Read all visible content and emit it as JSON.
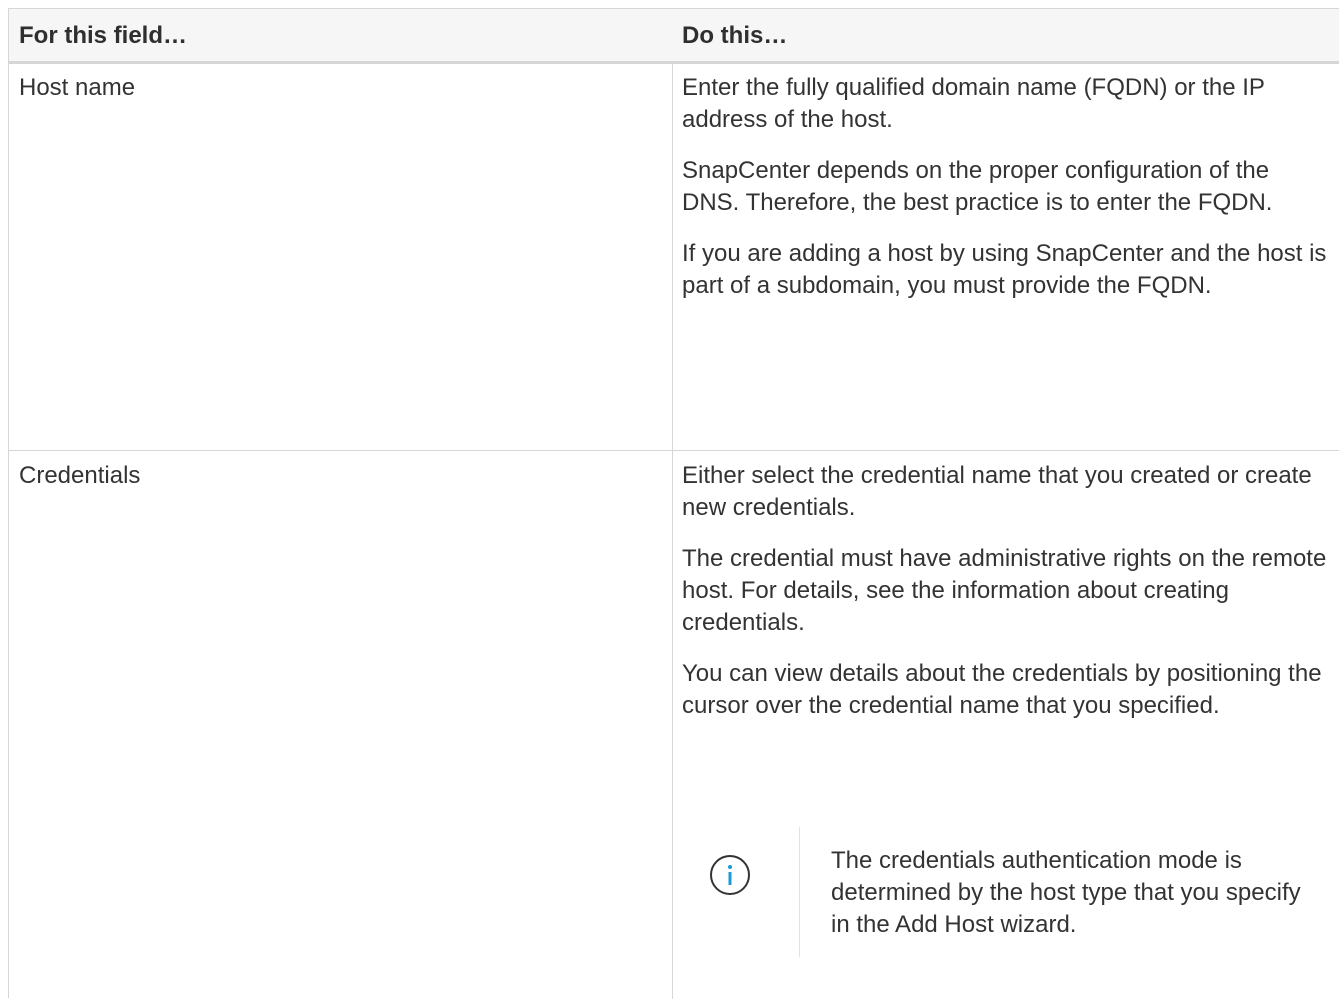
{
  "table": {
    "headers": {
      "field": "For this field…",
      "action": "Do this…"
    },
    "rows": [
      {
        "field": "Host name",
        "paragraphs": [
          "Enter the fully qualified domain name (FQDN) or the IP address of the host.",
          "SnapCenter depends on the proper configuration of the DNS. Therefore, the best practice is to enter the FQDN.",
          "If you are adding a host by using SnapCenter and the host is part of a subdomain, you must provide the FQDN."
        ]
      },
      {
        "field": "Credentials",
        "paragraphs": [
          "Either select the credential name that you created or create new credentials.",
          "The credential must have administrative rights on the remote host. For details, see the information about creating credentials.",
          "You can view details about the credentials by positioning the cursor over the credential name that you specified."
        ],
        "note": {
          "icon": "info-icon",
          "text": "The credentials authentication mode is determined by the host type that you specify in the Add Host wizard."
        }
      }
    ]
  },
  "colors": {
    "border": "#d6d6d6",
    "header_bg": "#f6f6f6",
    "text": "#333333",
    "info_icon": "#1a9bd7"
  }
}
